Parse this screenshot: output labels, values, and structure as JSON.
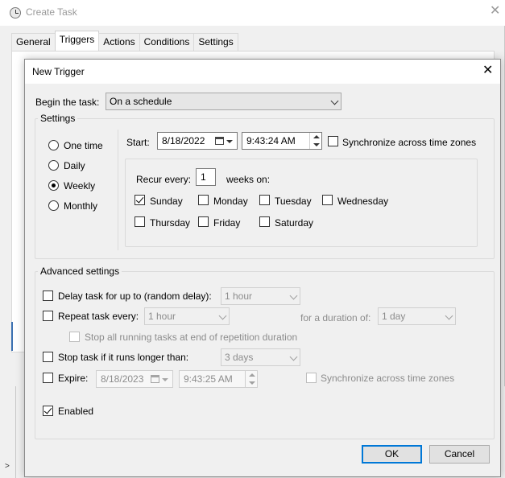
{
  "background_window": {
    "title": "Create Task",
    "tabs": [
      "General",
      "Triggers",
      "Actions",
      "Conditions",
      "Settings"
    ],
    "active_tab": "Triggers"
  },
  "dialog": {
    "title": "New Trigger",
    "begin_label": "Begin the task:",
    "begin_value": "On a schedule",
    "settings_title": "Settings",
    "schedule_options": [
      "One time",
      "Daily",
      "Weekly",
      "Monthly"
    ],
    "selected_schedule": "Weekly",
    "start_label": "Start:",
    "start_date": "8/18/2022",
    "start_time": "9:43:24 AM",
    "sync_label": "Synchronize across time zones",
    "sync_checked": false,
    "recur_label": "Recur every:",
    "recur_value": "1",
    "weeks_on_label": "weeks on:",
    "days": [
      {
        "label": "Sunday",
        "checked": true
      },
      {
        "label": "Monday",
        "checked": false
      },
      {
        "label": "Tuesday",
        "checked": false
      },
      {
        "label": "Wednesday",
        "checked": false
      },
      {
        "label": "Thursday",
        "checked": false
      },
      {
        "label": "Friday",
        "checked": false
      },
      {
        "label": "Saturday",
        "checked": false
      }
    ],
    "advanced_title": "Advanced settings",
    "delay_label": "Delay task for up to (random delay):",
    "delay_value": "1 hour",
    "repeat_label": "Repeat task every:",
    "repeat_value": "1 hour",
    "duration_label": "for a duration of:",
    "duration_value": "1 day",
    "stop_running_label": "Stop all running tasks at end of repetition duration",
    "stop_longer_label": "Stop task if it runs longer than:",
    "stop_longer_value": "3 days",
    "expire_label": "Expire:",
    "expire_date": "8/18/2023",
    "expire_time": "9:43:25 AM",
    "expire_sync_label": "Synchronize across time zones",
    "enabled_label": "Enabled",
    "enabled_checked": true,
    "ok_label": "OK",
    "cancel_label": "Cancel"
  },
  "icons": {
    "app": "task-scheduler-clock-icon",
    "close": "close-icon",
    "calendar": "calendar-icon",
    "dropdown": "chevron-down-icon"
  }
}
